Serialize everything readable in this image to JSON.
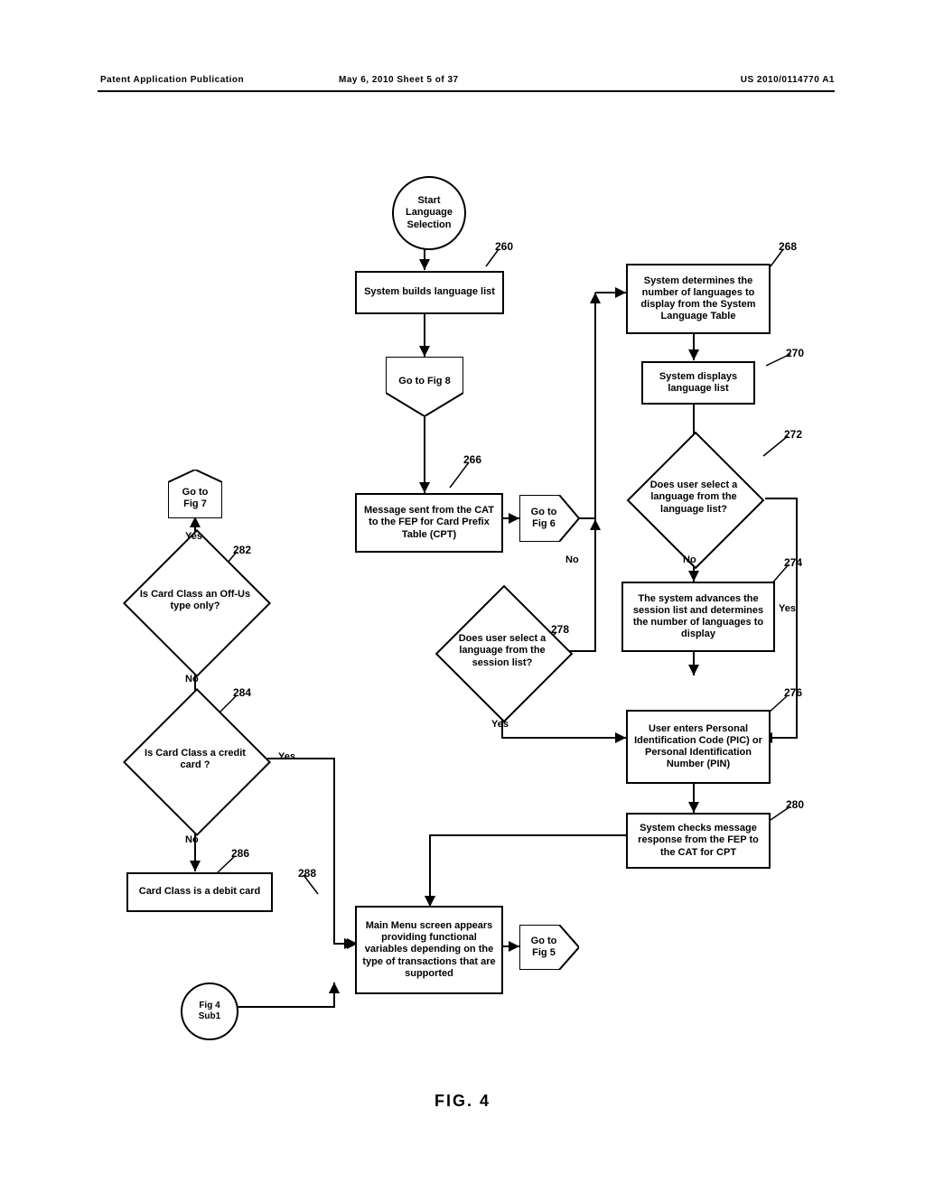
{
  "header": {
    "left": "Patent Application Publication",
    "center": "May 6, 2010  Sheet 5 of 37",
    "right": "US 2010/0114770 A1"
  },
  "figcaption": "FIG. 4",
  "start": {
    "label": "Start\nLanguage\nSelection"
  },
  "n260": {
    "num": "260",
    "label": "System builds language list"
  },
  "gofig8": {
    "label": "Go to Fig 8"
  },
  "n266": {
    "num": "266",
    "label": "Message sent from the CAT to the FEP for Card Prefix Table (CPT)"
  },
  "gofig6": {
    "label": "Go to\nFig 6"
  },
  "n268": {
    "num": "268",
    "label": "System determines the number of languages to display from the System Language Table"
  },
  "n270": {
    "num": "270",
    "label": "System displays language list"
  },
  "n272": {
    "num": "272",
    "label": "Does user select a language from the language list?"
  },
  "n274": {
    "num": "274",
    "label": "The system advances the session list and determines the number of languages to display"
  },
  "n276": {
    "num": "276",
    "label": "User enters Personal Identification Code (PIC) or Personal Identification Number (PIN)"
  },
  "n278": {
    "num": "278",
    "label": "Does user select a language from the session list?"
  },
  "n280": {
    "num": "280",
    "label": "System checks message response from the FEP to the CAT for CPT"
  },
  "gofig7": {
    "label": "Go to\nFig 7"
  },
  "n282": {
    "num": "282",
    "label": "Is Card Class an Off-Us type only?"
  },
  "n284": {
    "num": "284",
    "label": "Is Card Class a credit card ?"
  },
  "n286": {
    "num": "286",
    "label": "Card Class is a debit  card"
  },
  "n288": {
    "num": "288",
    "label": "Main Menu screen appears providing functional variables depending on the type of transactions that are supported"
  },
  "gofig5": {
    "label": "Go to\nFig 5"
  },
  "fig4sub1": {
    "label": "Fig 4\nSub1"
  },
  "edges": {
    "yes": "Yes",
    "no": "No"
  }
}
